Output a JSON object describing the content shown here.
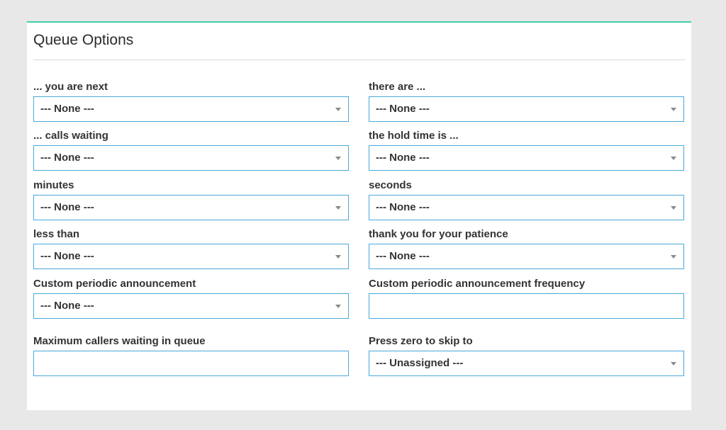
{
  "panel": {
    "title": "Queue Options",
    "accent_color": "#3ecfb0",
    "field_border_color": "#4aa8d8"
  },
  "fields": {
    "you_are_next": {
      "label": "... you are next",
      "value": "--- None ---"
    },
    "there_are": {
      "label": "there are ...",
      "value": "--- None ---"
    },
    "calls_waiting": {
      "label": "... calls waiting",
      "value": "--- None ---"
    },
    "hold_time_is": {
      "label": "the hold time is ...",
      "value": "--- None ---"
    },
    "minutes": {
      "label": "minutes",
      "value": "--- None ---"
    },
    "seconds": {
      "label": "seconds",
      "value": "--- None ---"
    },
    "less_than": {
      "label": "less than",
      "value": "--- None ---"
    },
    "thank_you": {
      "label": "thank you for your patience",
      "value": "--- None ---"
    },
    "custom_announcement": {
      "label": "Custom periodic announcement",
      "value": "--- None ---"
    },
    "announcement_frequency": {
      "label": "Custom periodic announcement frequency",
      "value": ""
    },
    "max_callers": {
      "label": "Maximum callers waiting in queue",
      "value": ""
    },
    "press_zero": {
      "label": "Press zero to skip to",
      "value": "--- Unassigned ---"
    }
  }
}
